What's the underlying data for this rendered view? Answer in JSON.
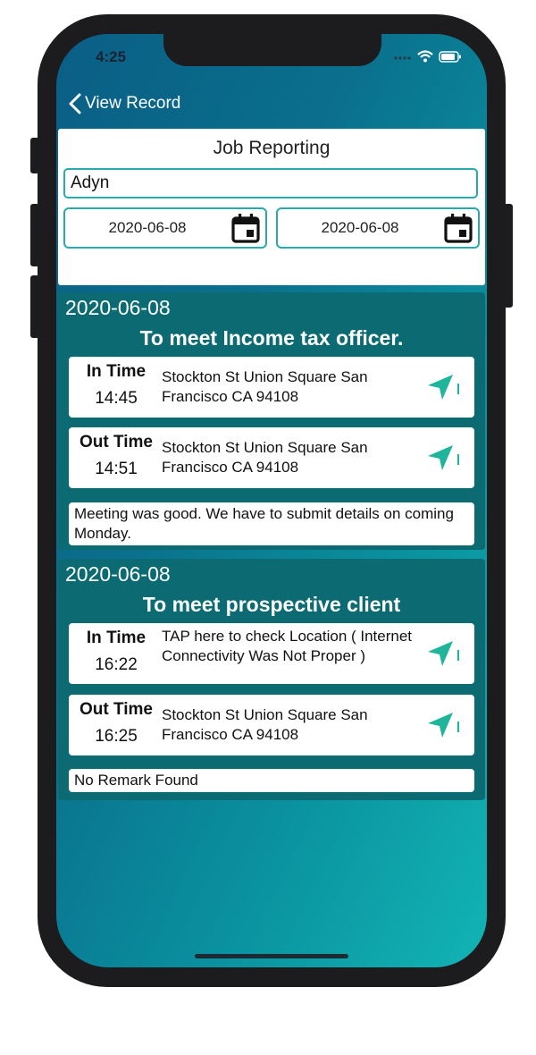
{
  "status_bar": {
    "time": "4:25"
  },
  "nav": {
    "back_label": "View Record"
  },
  "filter": {
    "title": "Job Reporting",
    "name_value": "Adyn",
    "from_date": "2020-06-08",
    "to_date": "2020-06-08"
  },
  "records": [
    {
      "date": "2020-06-08",
      "title": "To meet Income tax officer.",
      "in": {
        "label": "In Time",
        "time": "14:45",
        "address": "Stockton St Union Square San Francisco CA 94108"
      },
      "out": {
        "label": "Out Time",
        "time": "14:51",
        "address": "Stockton St Union Square San Francisco CA 94108"
      },
      "remark": "Meeting was good. We have to submit details on coming Monday."
    },
    {
      "date": "2020-06-08",
      "title": "To meet prospective client",
      "in": {
        "label": "In Time",
        "time": "16:22",
        "address": "TAP here to check Location ( Internet Connectivity Was Not Proper )"
      },
      "out": {
        "label": "Out Time",
        "time": "16:25",
        "address": "Stockton St Union Square San Francisco CA 94108"
      },
      "remark": "No Remark Found"
    }
  ],
  "colors": {
    "accent": "#2aa9a9",
    "card_bg": "#0c6b72",
    "location_icon": "#1fb59a"
  },
  "icons": {
    "back": "chevron-left-icon",
    "calendar": "calendar-icon",
    "location": "navigation-arrow-icon"
  }
}
